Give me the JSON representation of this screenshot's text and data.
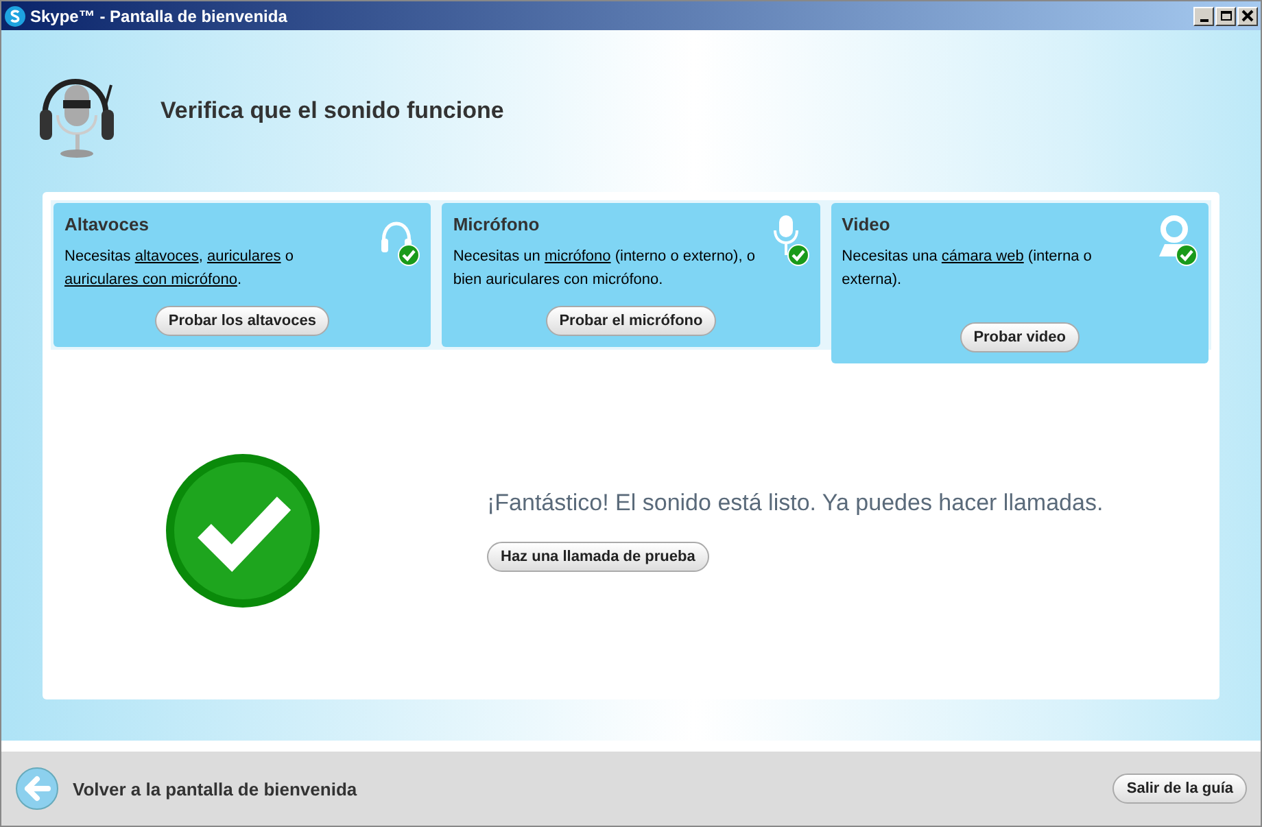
{
  "window": {
    "title": "Skype™ - Pantalla de bienvenida"
  },
  "header": {
    "title": "Verifica que el sonido funcione"
  },
  "cards": [
    {
      "kind": "speakers",
      "title": "Altavoces",
      "selected": false,
      "ok": true,
      "description": [
        {
          "text": "Necesitas ",
          "link": false
        },
        {
          "text": "altavoces",
          "link": true
        },
        {
          "text": ", ",
          "link": false
        },
        {
          "text": "auriculares",
          "link": true
        },
        {
          "text": " o ",
          "link": false
        },
        {
          "text": "auriculares con micrófono",
          "link": true
        },
        {
          "text": ".",
          "link": false
        }
      ],
      "button": "Probar los altavoces"
    },
    {
      "kind": "microphone",
      "title": "Micrófono",
      "selected": false,
      "ok": true,
      "description": [
        {
          "text": "Necesitas un ",
          "link": false
        },
        {
          "text": "micrófono",
          "link": true
        },
        {
          "text": " (interno o externo), o bien auriculares con micrófono.",
          "link": false
        }
      ],
      "button": "Probar el micrófono"
    },
    {
      "kind": "video",
      "title": "Video",
      "selected": true,
      "ok": true,
      "description": [
        {
          "text": "Necesitas una ",
          "link": false
        },
        {
          "text": "cámara web",
          "link": true
        },
        {
          "text": " (interna o externa).",
          "link": false
        }
      ],
      "button": "Probar video"
    }
  ],
  "result": {
    "ok": true,
    "message": "¡Fantástico! El sonido está listo. Ya puedes hacer llamadas.",
    "button": "Haz una llamada de prueba"
  },
  "footer": {
    "back": "Volver a la pantalla de bienvenida",
    "exit": "Salir de la guía"
  }
}
